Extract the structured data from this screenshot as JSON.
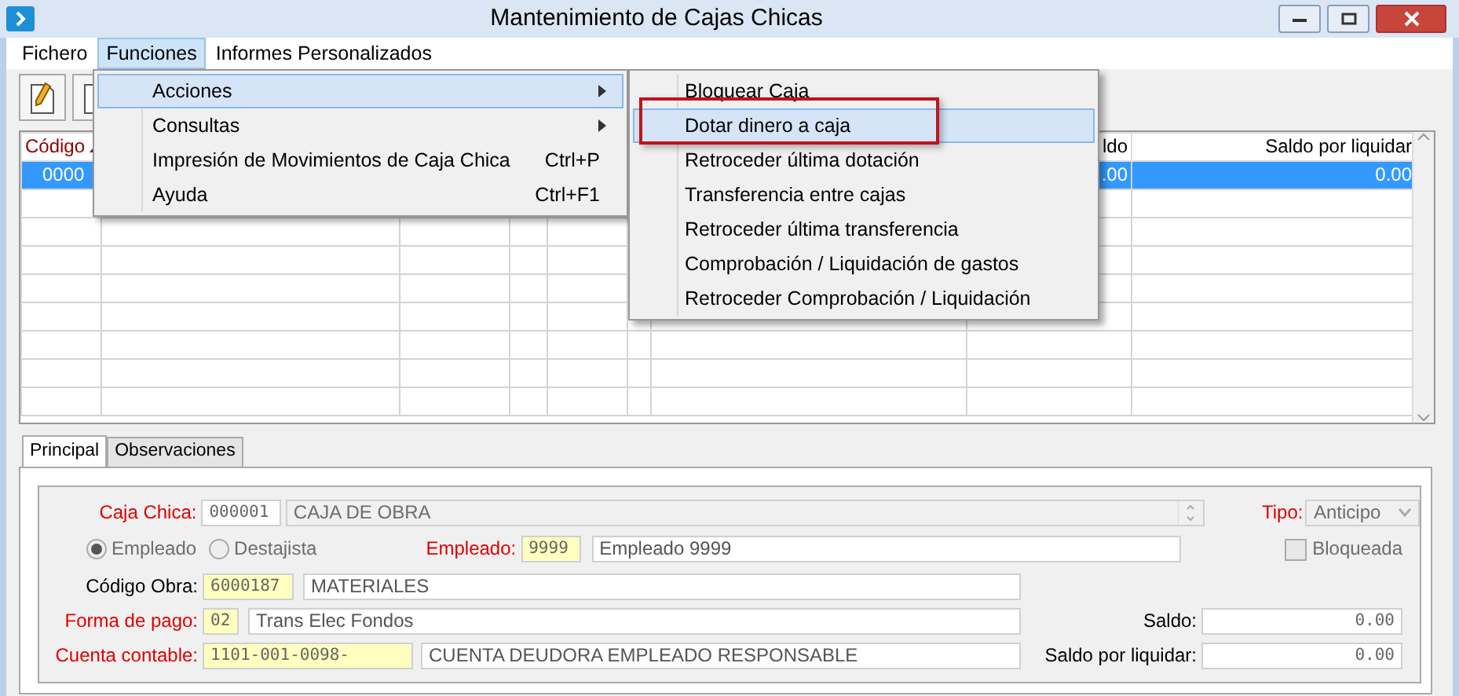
{
  "window": {
    "title": "Mantenimiento de Cajas Chicas"
  },
  "menu_bar": [
    {
      "label": "Fichero",
      "selected": false
    },
    {
      "label": "Funciones",
      "selected": true
    },
    {
      "label": "Informes Personalizados",
      "selected": false
    }
  ],
  "menu": {
    "items": [
      {
        "label": "Acciones",
        "has_submenu": true,
        "selected": true
      },
      {
        "label": "Consultas",
        "has_submenu": true,
        "selected": false
      },
      {
        "label": "Impresión de Movimientos de Caja Chica",
        "shortcut": "Ctrl+P",
        "has_submenu": false,
        "selected": false
      },
      {
        "label": "Ayuda",
        "shortcut": "Ctrl+F1",
        "has_submenu": false,
        "selected": false
      }
    ]
  },
  "submenu": {
    "items": [
      {
        "label": "Bloquear Caja",
        "selected": false,
        "outlined": false
      },
      {
        "label": "Dotar dinero a caja",
        "selected": true,
        "outlined": true
      },
      {
        "label": "Retroceder última dotación",
        "selected": false,
        "outlined": false
      },
      {
        "label": "Transferencia entre cajas",
        "selected": false,
        "outlined": false
      },
      {
        "label": "Retroceder última transferencia",
        "selected": false,
        "outlined": false
      },
      {
        "label": "Comprobación / Liquidación de gastos",
        "selected": false,
        "outlined": false
      },
      {
        "label": "Retroceder Comprobación / Liquidación",
        "selected": false,
        "outlined": false
      }
    ]
  },
  "grid": {
    "columns": [
      {
        "label": "Código",
        "sorted": true
      },
      {
        "label": "ldo",
        "sorted": false
      },
      {
        "label": "Saldo por liquidar",
        "sorted": false
      }
    ],
    "rows": [
      {
        "selected": true,
        "cells": [
          "0000",
          ".00",
          "0.00"
        ]
      }
    ]
  },
  "tabs": [
    {
      "label": "Principal",
      "selected": true
    },
    {
      "label": "Observaciones",
      "selected": false
    }
  ],
  "form": {
    "caja_chica": {
      "label": "Caja Chica:",
      "required": true,
      "code": "000001",
      "code_highlighted": false,
      "name": "CAJA DE OBRA"
    },
    "tipo": {
      "label": "Tipo:",
      "required": true,
      "value": "Anticipo"
    },
    "holder_type": [
      {
        "label": "Empleado",
        "selected": true
      },
      {
        "label": "Destajista",
        "selected": false
      }
    ],
    "empleado": {
      "label": "Empleado:",
      "required": true,
      "code": "9999",
      "code_highlighted": true,
      "name": "Empleado 9999"
    },
    "bloqueada": {
      "label": "Bloqueada",
      "checked": false
    },
    "codigo_obra": {
      "label": "Código Obra:",
      "required": false,
      "code": "6000187",
      "code_highlighted": true,
      "name": "MATERIALES"
    },
    "forma_pago": {
      "label": "Forma de pago:",
      "required": true,
      "code": "02",
      "code_highlighted": true,
      "name": "Trans Elec Fondos"
    },
    "saldo": {
      "label": "Saldo:",
      "value": "0.00"
    },
    "cuenta_contable": {
      "label": "Cuenta contable:",
      "required": true,
      "code": "1101-001-0098-",
      "code_highlighted": true,
      "name": "CUENTA DEUDORA EMPLEADO RESPONSABLE"
    },
    "saldo_por_liquidar": {
      "label": "Saldo por liquidar:",
      "value": "0.00"
    }
  }
}
